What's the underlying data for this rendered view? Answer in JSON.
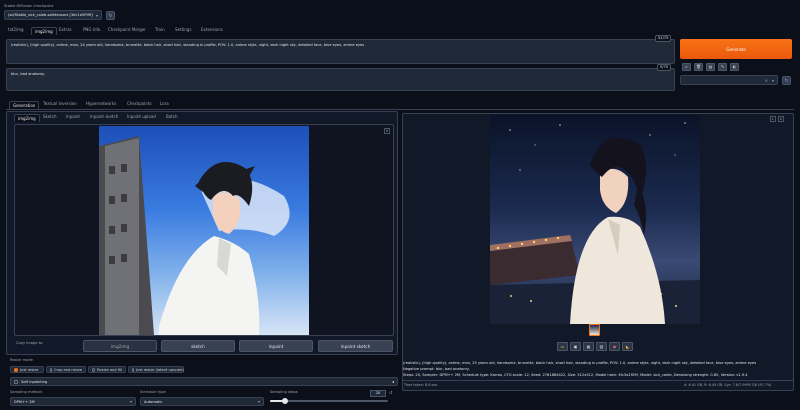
{
  "checkpoint": {
    "label": "Stable Diffusion checkpoint",
    "value": "(sd/Stable_sick_caleb.safetensors [3dc1a5f99f]"
  },
  "top_tabs": [
    "txt2img",
    "img2img",
    "Extras",
    "PNG Info",
    "Checkpoint Merger",
    "Train",
    "Settings",
    "Extensions"
  ],
  "prompt": {
    "text": "(realistic), (high quality), anime, man, 24 years old, handsome, brunette, black hair, short hair, standing in profile, POV: 1.0, anime style, night, dark night sky, detailed face, blue eyes, anime eyes",
    "counter": "52/75"
  },
  "negative_prompt": {
    "text": "blur, bad anatomy,",
    "counter": "5/75"
  },
  "generate_label": "Generate",
  "sub_tabs": [
    "Generation",
    "Textual Inversion",
    "Hypernetworks",
    "Checkpoints",
    "Lora"
  ],
  "img_tabs": [
    "img2img",
    "Sketch",
    "Inpaint",
    "Inpaint sketch",
    "Inpaint upload",
    "Batch"
  ],
  "copy_label": "Copy image to:",
  "copy_buttons": [
    "img2img",
    "sketch",
    "inpaint",
    "inpaint sketch"
  ],
  "resize": {
    "label": "Resize mode",
    "options": [
      "Just resize",
      "Crop and resize",
      "Resize and fill",
      "Just resize (latent upscale)"
    ]
  },
  "soft_inpainting": "Soft inpainting",
  "sampling_method": {
    "label": "Sampling method",
    "value": "DPM++ 2M"
  },
  "schedule_type": {
    "label": "Schedule type",
    "value": "Automatic"
  },
  "sampling_steps": {
    "label": "Sampling steps",
    "value": "20",
    "level": 0.13
  },
  "info": {
    "line1": "(realistic), (high quality), anime, man, 25 years old, handsome, brunette, black hair, short hair, standing in profile, POV: 1.0, anime style, night, dark night sky, detailed face, blue eyes, anime eyes",
    "line2": "Negative prompt: blur, bad anatomy,",
    "line3": "Steps: 20, Sampler: DPM++ 2M, Schedule type: Karras, CFG scale: 12, Seed: 2761884422, Size: 512x512, Model hash: 4fc3a1f09f, Model: sick_caleb, Denoising strength: 0.85, Version: v1.9.4",
    "time": "Time taken: 8.8 sec.",
    "vram": "A: 6.41 GB, R: 6.49 GB, Sys: 7.8/7.9995 GB (97.7%)"
  },
  "colors": {
    "accent": "#f97316",
    "bg": "#0b0f19",
    "panel": "#1f2937"
  }
}
